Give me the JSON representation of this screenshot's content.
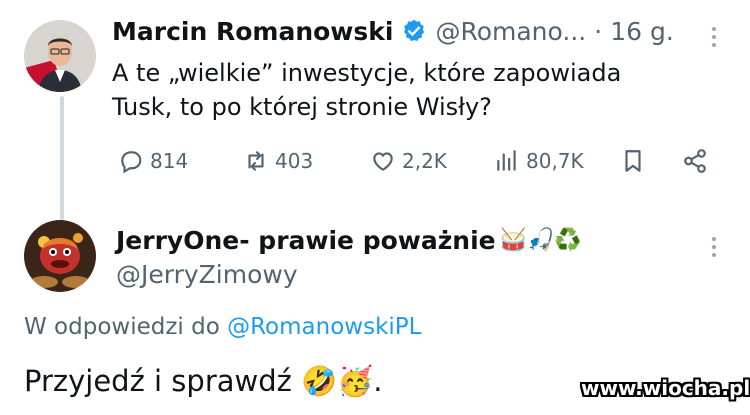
{
  "tweet": {
    "author_name": "Marcin Romanowski",
    "author_handle": "@Romano...",
    "separator": "·",
    "timestamp": "16 g.",
    "text_line1": "A te „wielkie” inwestycje, które zapowiada",
    "text_line2": "Tusk, to po której stronie Wisły?",
    "stats": {
      "replies": "814",
      "reposts": "403",
      "likes": "2,2K",
      "views": "80,7K"
    }
  },
  "reply": {
    "author_name": "JerryOne- prawie poważnie",
    "author_emojis": "🥁🎣♻️",
    "author_handle": "@JerryZimowy",
    "reply_to_prefix": "W odpowiedzi do ",
    "reply_to_handle": "@RomanowskiPL",
    "text": "Przyjedź i sprawdź 🤣🥳."
  },
  "watermark": "www.wiocha.pl",
  "colors": {
    "text": "#0f1419",
    "secondary": "#536471",
    "link": "#1d9bf0",
    "verified": "#1d9bf0"
  }
}
